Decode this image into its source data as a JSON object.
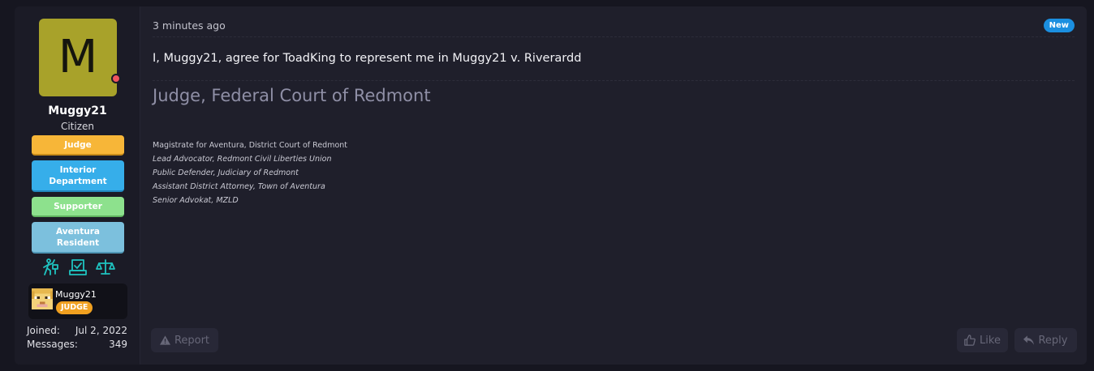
{
  "user": {
    "avatar_letter": "M",
    "avatar_color": "#a8a22a",
    "status": "online-dot",
    "name": "Muggy21",
    "title": "Citizen",
    "banners": [
      {
        "label": "Judge",
        "color": "#f7b638"
      },
      {
        "label": "Interior Department",
        "color": "#36aeea"
      },
      {
        "label": "Supporter",
        "color": "#8de18d"
      },
      {
        "label": "Aventura Resident",
        "color": "#7cc0dd"
      }
    ],
    "trophy_icons": [
      "advocate-icon",
      "voting-icon",
      "scales-icon"
    ],
    "mc": {
      "name": "Muggy21",
      "badge": "JUDGE",
      "badge_color": "#f0a020"
    },
    "joined_label": "Joined:",
    "joined_value": "Jul 2, 2022",
    "messages_label": "Messages:",
    "messages_value": "349"
  },
  "post": {
    "time": "3 minutes ago",
    "new_badge": "New",
    "message": "I, Muggy21, agree for ToadKing to represent me in Muggy21 v. Riverardd",
    "signature": {
      "title": "Judge, Federal Court of Redmont",
      "lines": [
        "Magistrate for Aventura, District Court of Redmont",
        "Lead Advocator, Redmont Civil Liberties Union",
        "Public Defender, Judiciary of Redmont",
        "Assistant District Attorney, Town of Aventura",
        "Senior Advokat, MZLD"
      ]
    },
    "actions": {
      "report": "Report",
      "like": "Like",
      "reply": "Reply"
    }
  }
}
